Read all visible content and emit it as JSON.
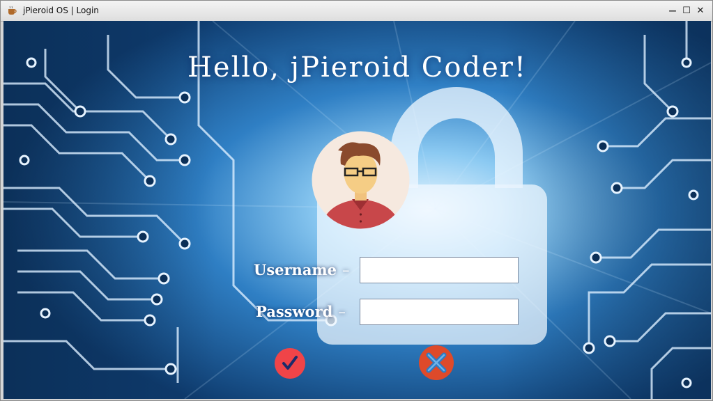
{
  "window": {
    "title": "jPieroid OS | Login",
    "icons": [
      "app-icon",
      "minimize-icon",
      "maximize-icon",
      "close-icon"
    ],
    "controls": {
      "minimize": "—",
      "maximize": "☐",
      "close": "✕"
    }
  },
  "login": {
    "greeting": "Hello, jPieroid Coder!",
    "avatar_icon": "user-avatar-icon",
    "background": "circuit-board-lock-image",
    "username_label": "Username",
    "password_label": "Password",
    "label_dash": "–",
    "username_value": "",
    "password_value": "",
    "confirm_icon": "checkmark-icon",
    "cancel_icon": "cancel-x-icon"
  },
  "colors": {
    "confirm_button": "#f04448",
    "cancel_button": "#de4a2a",
    "cancel_x": "#2f7cc4",
    "background_blue": "#1a63a8"
  }
}
